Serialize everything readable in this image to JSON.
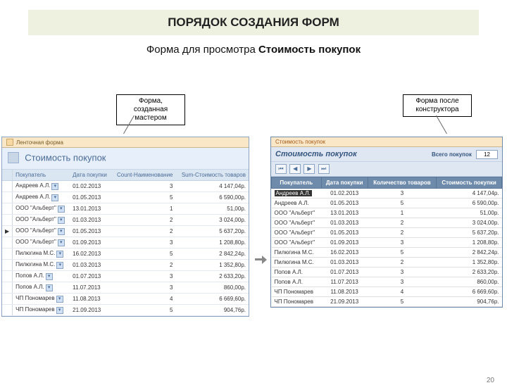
{
  "title": "ПОРЯДОК СОЗДАНИЯ ФОРМ",
  "subtitle_prefix": "Форма для просмотра ",
  "subtitle_bold": "Стоимость покупок",
  "callout_left": "Форма, созданная мастером",
  "callout_right": "Форма после конструктора",
  "page_number": "20",
  "wizard": {
    "tab_label": "Ленточная форма",
    "form_title": "Стоимость покупок",
    "columns": [
      "Покупатель",
      "Дата покупки",
      "Count-Наименование",
      "Sum-Стоимость товаров"
    ],
    "rows": [
      [
        "Андреев А.Л.",
        "01.02.2013",
        "3",
        "4 147,04р."
      ],
      [
        "Андреев А.Л.",
        "01.05.2013",
        "5",
        "6 590,00р."
      ],
      [
        "ООО \"Альберт\"",
        "13.01.2013",
        "1",
        "51,00р."
      ],
      [
        "ООО \"Альберт\"",
        "01.03.2013",
        "2",
        "3 024,00р."
      ],
      [
        "ООО \"Альберт\"",
        "01.05.2013",
        "2",
        "5 637,20р."
      ],
      [
        "ООО \"Альберт\"",
        "01.09.2013",
        "3",
        "1 208,80р."
      ],
      [
        "Пилюгина М.С.",
        "16.02.2013",
        "5",
        "2 842,24р."
      ],
      [
        "Пилюгина М.С.",
        "01.03.2013",
        "2",
        "1 352,80р."
      ],
      [
        "Попов А.Л.",
        "01.07.2013",
        "3",
        "2 633,20р."
      ],
      [
        "Попов А.Л.",
        "11.07.2013",
        "3",
        "860,00р."
      ],
      [
        "ЧП Пономарев",
        "11.08.2013",
        "4",
        "6 669,60р."
      ],
      [
        "ЧП Пономарев",
        "21.09.2013",
        "5",
        "904,76р."
      ]
    ]
  },
  "designer": {
    "tab_label": "Стоимость покупок",
    "form_title": "Стоимость покупок",
    "count_label": "Всего покупок",
    "count_value": "12",
    "nav": [
      "⏮",
      "◀",
      "▶",
      "⏭"
    ],
    "columns": [
      "Покупатель",
      "Дата покупки",
      "Количество товаров",
      "Стоимость покупки"
    ],
    "rows": [
      [
        "Андреев А.Л.",
        "01.02.2013",
        "3",
        "4 147,04р."
      ],
      [
        "Андреев А.Л.",
        "01.05.2013",
        "5",
        "6 590,00р."
      ],
      [
        "ООО \"Альберт\"",
        "13.01.2013",
        "1",
        "51,00р."
      ],
      [
        "ООО \"Альберт\"",
        "01.03.2013",
        "2",
        "3 024,00р."
      ],
      [
        "ООО \"Альберт\"",
        "01.05.2013",
        "2",
        "5 637,20р."
      ],
      [
        "ООО \"Альберт\"",
        "01.09.2013",
        "3",
        "1 208,80р."
      ],
      [
        "Пилюгина М.С.",
        "16.02.2013",
        "5",
        "2 842,24р."
      ],
      [
        "Пилюгина М.С.",
        "01.03.2013",
        "2",
        "1 352,80р."
      ],
      [
        "Попов А.Л.",
        "01.07.2013",
        "3",
        "2 633,20р."
      ],
      [
        "Попов А.Л.",
        "11.07.2013",
        "3",
        "860,00р."
      ],
      [
        "ЧП Пономарев",
        "11.08.2013",
        "4",
        "6 669,60р."
      ],
      [
        "ЧП Пономарев",
        "21.09.2013",
        "5",
        "904,76р."
      ]
    ]
  }
}
